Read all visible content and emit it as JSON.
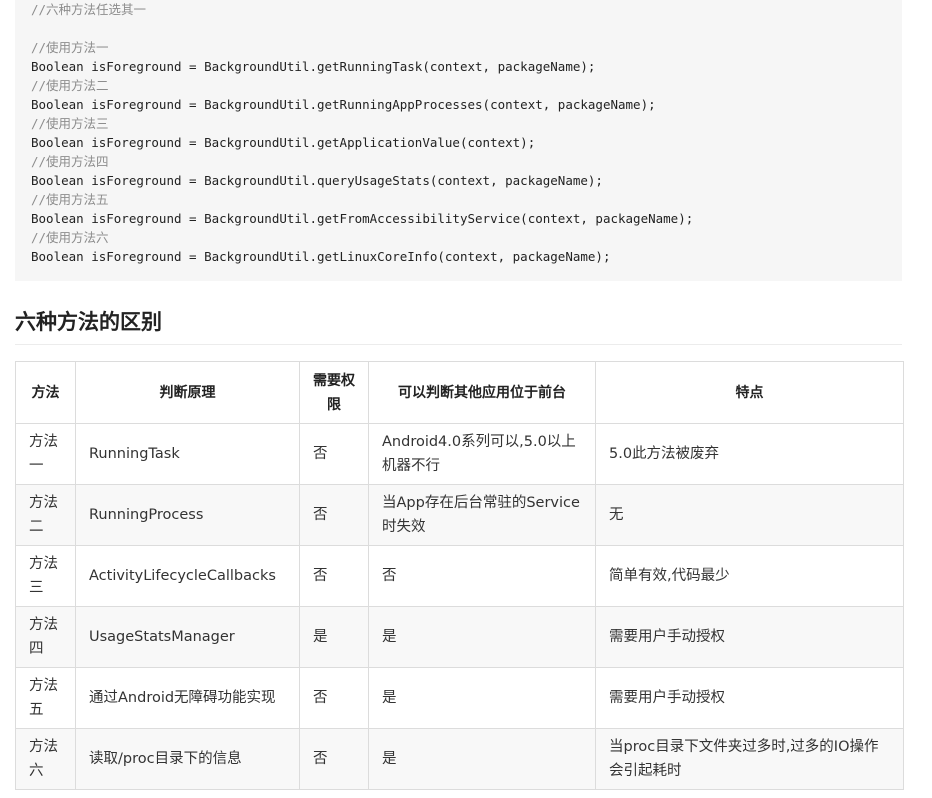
{
  "code": {
    "header_comment": "//六种方法任选其一",
    "methods": [
      {
        "comment": "//使用方法一",
        "statement": "Boolean isForeground = BackgroundUtil.getRunningTask(context, packageName);"
      },
      {
        "comment": "//使用方法二",
        "statement": "Boolean isForeground = BackgroundUtil.getRunningAppProcesses(context, packageName);"
      },
      {
        "comment": "//使用方法三",
        "statement": "Boolean isForeground = BackgroundUtil.getApplicationValue(context);"
      },
      {
        "comment": "//使用方法四",
        "statement": "Boolean isForeground = BackgroundUtil.queryUsageStats(context, packageName);"
      },
      {
        "comment": "//使用方法五",
        "statement": "Boolean isForeground = BackgroundUtil.getFromAccessibilityService(context, packageName);"
      },
      {
        "comment": "//使用方法六",
        "statement": "Boolean isForeground = BackgroundUtil.getLinuxCoreInfo(context, packageName);"
      }
    ]
  },
  "section": {
    "title": "六种方法的区别"
  },
  "table": {
    "headers": {
      "method": "方法",
      "principle": "判断原理",
      "permission": "需要权限",
      "other_apps": "可以判断其他应用位于前台",
      "features": "特点"
    },
    "rows": [
      {
        "method": "方法一",
        "principle": "RunningTask",
        "permission": "否",
        "other_apps": "Android4.0系列可以,5.0以上机器不行",
        "features": "5.0此方法被废弃"
      },
      {
        "method": "方法二",
        "principle": "RunningProcess",
        "permission": "否",
        "other_apps": "当App存在后台常驻的Service时失效",
        "features": "无"
      },
      {
        "method": "方法三",
        "principle": "ActivityLifecycleCallbacks",
        "permission": "否",
        "other_apps": "否",
        "features": "简单有效,代码最少"
      },
      {
        "method": "方法四",
        "principle": "UsageStatsManager",
        "permission": "是",
        "other_apps": "是",
        "features": "需要用户手动授权"
      },
      {
        "method": "方法五",
        "principle": "通过Android无障碍功能实现",
        "permission": "否",
        "other_apps": "是",
        "features": "需要用户手动授权"
      },
      {
        "method": "方法六",
        "principle": "读取/proc目录下的信息",
        "permission": "否",
        "other_apps": "是",
        "features": "当proc目录下文件夹过多时,过多的IO操作会引起耗时"
      }
    ]
  }
}
